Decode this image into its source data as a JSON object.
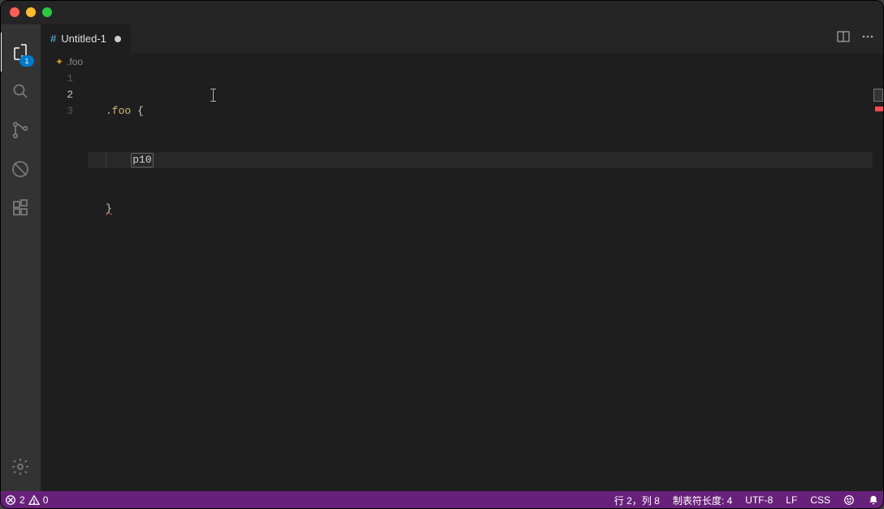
{
  "window": {
    "title": ""
  },
  "activity": {
    "explorer_badge": "1"
  },
  "tabs": {
    "active": {
      "filetype_glyph": "#",
      "label": "Untitled-1"
    }
  },
  "breadcrumb": {
    "items": [
      ".foo"
    ]
  },
  "editor": {
    "lines": {
      "n1": "1",
      "n2": "2",
      "n3": "3"
    },
    "code": {
      "l1_selector": ".foo",
      "l1_open": " {",
      "l2_text": "p10",
      "l3_close": "}"
    }
  },
  "statusbar": {
    "errors_count": "2",
    "warnings_count": "0",
    "cursor_pos": "行 2，列 8",
    "tab_size": "制表符长度: 4",
    "encoding": "UTF-8",
    "eol": "LF",
    "language": "CSS"
  }
}
